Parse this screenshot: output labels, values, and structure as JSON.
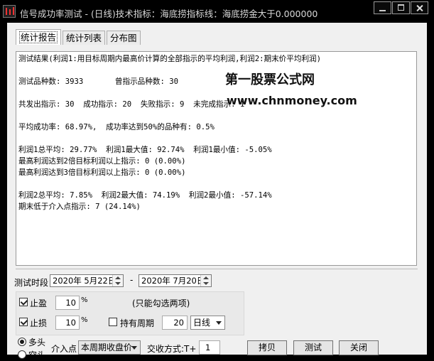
{
  "window": {
    "title": "信号成功率测试 - (日线)技术指标：海底捞指标线：海底捞金大于0.000000"
  },
  "tabs": [
    {
      "label": "统计报告"
    },
    {
      "label": "统计列表"
    },
    {
      "label": "分布图"
    }
  ],
  "report_lines": [
    "测试结果(利润1:用目标周期内最高价计算的全部指示的平均利润,利润2:期末价平均利润)",
    "",
    "测试品种数: 3933       曾指示品种数: 30",
    "",
    "共发出指示: 30  成功指示: 20  失败指示: 9  未完成指示: 1",
    "",
    "平均成功率: 68.97%,  成功率达到50%的品种有: 0.5%",
    "",
    "利润1总平均: 29.77%  利润1最大值: 92.74%  利润1最小值: -5.05%",
    "最高利润达到2倍目标利润以上指示: 0 (0.00%)",
    "最高利润达到3倍目标利润以上指示: 0 (0.00%)",
    "",
    "利润2总平均: 7.85%  利润2最大值: 74.19%  利润2最小值: -57.14%",
    "期末低于介入点指示: 7 (24.14%)"
  ],
  "watermark": {
    "line1": "第一股票公式网",
    "line2": "www.chnmoney.com"
  },
  "period": {
    "label": "测试时段",
    "start": "2020年 5月22日",
    "dash": "-",
    "end": "2020年 7月20日"
  },
  "options": {
    "stop_profit": {
      "label": "止盈",
      "value": "10",
      "unit": "%",
      "checked": true
    },
    "stop_loss": {
      "label": "止损",
      "value": "10",
      "unit": "%",
      "checked": true
    },
    "note": "(只能勾选两项)",
    "hold_period": {
      "label": "持有周期",
      "value": "20",
      "unit": "日线",
      "checked": false
    }
  },
  "direction": {
    "long": "多头",
    "short": "空头",
    "selected": "long"
  },
  "entry": {
    "label": "介入点",
    "value": "本周期收盘价"
  },
  "trade": {
    "label": "交收方式:T+",
    "value": "1"
  },
  "buttons": {
    "copy": "拷贝",
    "test": "测试",
    "close": "关闭"
  }
}
